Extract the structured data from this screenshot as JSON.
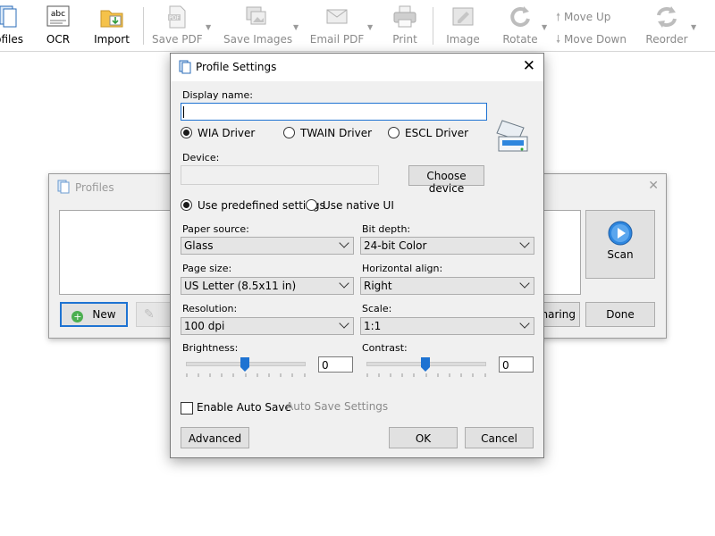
{
  "toolbar": {
    "profiles": "Profiles",
    "ocr": "OCR",
    "import": "Import",
    "save_pdf": "Save PDF",
    "save_images": "Save Images",
    "email_pdf": "Email PDF",
    "print": "Print",
    "image": "Image",
    "rotate": "Rotate",
    "move_up": "Move Up",
    "move_down": "Move Down",
    "reorder": "Reorder",
    "ocr_icon_text": "abc",
    "pdf_icon_text": "PDF"
  },
  "profiles_window": {
    "title": "Profiles",
    "new_button": "New",
    "scan_button": "Scan",
    "sharing_button": "Sharing",
    "done_button": "Done"
  },
  "dialog": {
    "title": "Profile Settings",
    "display_name_label": "Display name:",
    "display_name_value": "",
    "driver_options": [
      "WIA Driver",
      "TWAIN Driver",
      "ESCL Driver"
    ],
    "driver_selected": "WIA Driver",
    "device_label": "Device:",
    "device_value": "",
    "choose_device_button": "Choose device",
    "mode_options": [
      "Use predefined settings",
      "Use native UI"
    ],
    "mode_selected": "Use predefined settings",
    "paper_source_label": "Paper source:",
    "paper_source_value": "Glass",
    "bit_depth_label": "Bit depth:",
    "bit_depth_value": "24-bit Color",
    "page_size_label": "Page size:",
    "page_size_value": "US Letter (8.5x11 in)",
    "horizontal_align_label": "Horizontal align:",
    "horizontal_align_value": "Right",
    "resolution_label": "Resolution:",
    "resolution_value": "100 dpi",
    "scale_label": "Scale:",
    "scale_value": "1:1",
    "brightness_label": "Brightness:",
    "brightness_value": "0",
    "brightness_level": 0.5,
    "contrast_label": "Contrast:",
    "contrast_value": "0",
    "contrast_level": 0.5,
    "auto_save_label": "Enable Auto Save",
    "auto_save_checked": false,
    "auto_save_settings_link": "Auto Save Settings",
    "advanced_button": "Advanced",
    "ok_button": "OK",
    "cancel_button": "Cancel"
  },
  "colors": {
    "accent": "#1e73d2",
    "disabled_text": "#8a8a8a",
    "button_face": "#e1e1e1"
  }
}
